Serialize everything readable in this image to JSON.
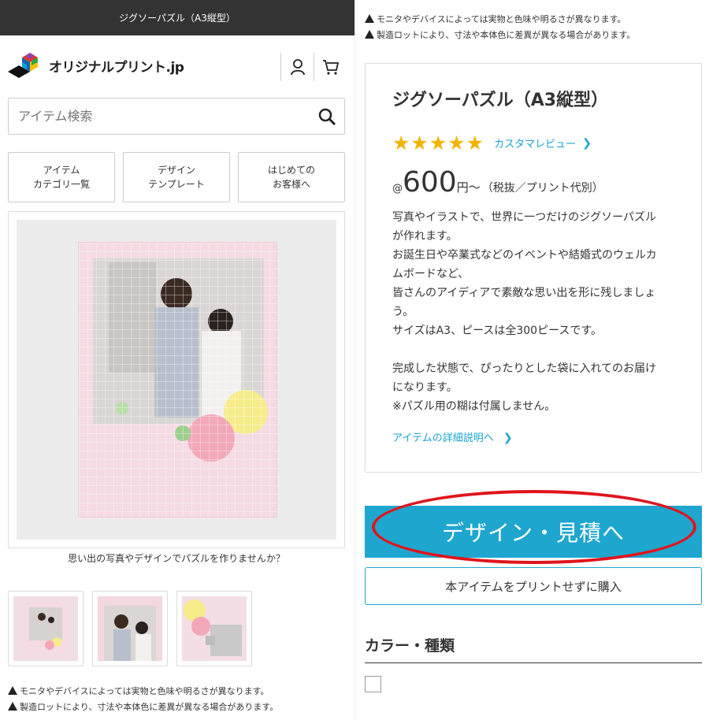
{
  "topbar": {
    "title": "ジグソーパズル（A3縦型）"
  },
  "header": {
    "logo_text": "オリジナルプリント.jp"
  },
  "search": {
    "placeholder": "アイテム検索"
  },
  "nav": [
    {
      "label": "アイテム\nカテゴリ一覧"
    },
    {
      "label": "デザイン\nテンプレート"
    },
    {
      "label": "はじめての\nお客様へ"
    }
  ],
  "main_image": {
    "caption": "思い出の写真やデザインでパズルを作りませんか？"
  },
  "notes": {
    "color_note": "モニタやデバイスによっては実物と色味や明るさが異なります。",
    "lot_note": "製造ロットにより、寸法や本体色に差異が異なる場合があります。"
  },
  "product": {
    "title": "ジグソーパズル（A3縦型）",
    "stars": "★★★★★",
    "rating": 5,
    "review_link": "カスタマレビュー",
    "price_prefix": "@",
    "price": "600",
    "price_unit": "円～",
    "price_note": "（税抜／プリント代別）",
    "description": "写真やイラストで、世界に一つだけのジグソーパズル\nが作れます。\nお誕生日や卒業式などのイベントや結婚式のウェルカ\nムボードなど、\n皆さんのアイディアで素敵な思い出を形に残しましょ\nう。\nサイズはA3、ピースは全300ピースです。\n\n完成した状態で、ぴったりとした袋に入れてのお届け\nになります。\n※パズル用の糊は付属しません。",
    "detail_link": "アイテムの詳細説明へ"
  },
  "actions": {
    "design_button": "デザイン・見積へ",
    "buy_button": "本アイテムをプリントせずに購入"
  },
  "options": {
    "section_title": "カラー・種類"
  },
  "colors": {
    "accent": "#1ea6cf",
    "link": "#1aa3d5",
    "star": "#f5b301",
    "highlight_ring": "#e0141b",
    "topbar": "#333333"
  }
}
